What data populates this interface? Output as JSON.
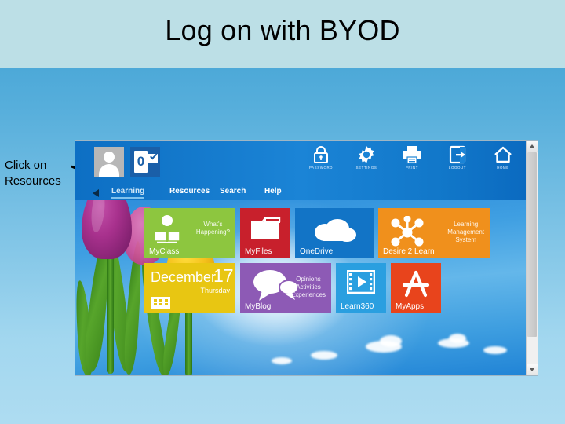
{
  "slide": {
    "title": "Log on with BYOD",
    "band_color": "#bcdfe6",
    "background_colors": [
      "#3c9fd3",
      "#aedcf1"
    ]
  },
  "annotation": {
    "line1": "Click on",
    "line2": "Resources",
    "points_to": "Resources"
  },
  "screenshot": {
    "header": {
      "avatar_label": "user-avatar",
      "mail": {
        "icon": "outlook-icon",
        "badge": "0"
      },
      "nav": [
        {
          "label": "Learning",
          "active": true
        },
        {
          "label": "Resources",
          "active": false
        },
        {
          "label": "Search",
          "active": false
        },
        {
          "label": "Help",
          "active": false
        }
      ],
      "tools": [
        {
          "label": "PASSWORD",
          "icon": "lock-icon"
        },
        {
          "label": "SETTINGS",
          "icon": "gear-icon"
        },
        {
          "label": "PRINT",
          "icon": "printer-icon"
        },
        {
          "label": "LOGOUT",
          "icon": "logout-icon"
        },
        {
          "label": "HOME",
          "icon": "home-icon"
        }
      ]
    },
    "tiles": {
      "myclass": {
        "name": "MyClass",
        "sub": "What's\nHappening?",
        "color": "#8dc63f"
      },
      "myfiles": {
        "name": "MyFiles",
        "sub": "",
        "color": "#c8202c"
      },
      "onedrive": {
        "name": "OneDrive",
        "sub": "",
        "color": "#1274c6"
      },
      "d2l": {
        "name": "Desire 2 Learn",
        "sub": "Learning\nManagement\nSystem",
        "color": "#f0901c"
      },
      "calendar": {
        "month": "December",
        "day": "17",
        "weekday": "Thursday",
        "color": "#e8c612"
      },
      "myblog": {
        "name": "MyBlog",
        "sub": "Opinions\nActivities\nExperiences",
        "color": "#8d5ab5"
      },
      "learn360": {
        "name": "Learn360",
        "sub": "",
        "color": "#2a9fe0"
      },
      "myapps": {
        "name": "MyApps",
        "sub": "",
        "color": "#e8441c"
      }
    },
    "scrollbar": {
      "up": "scroll-up",
      "down": "scroll-down"
    }
  }
}
